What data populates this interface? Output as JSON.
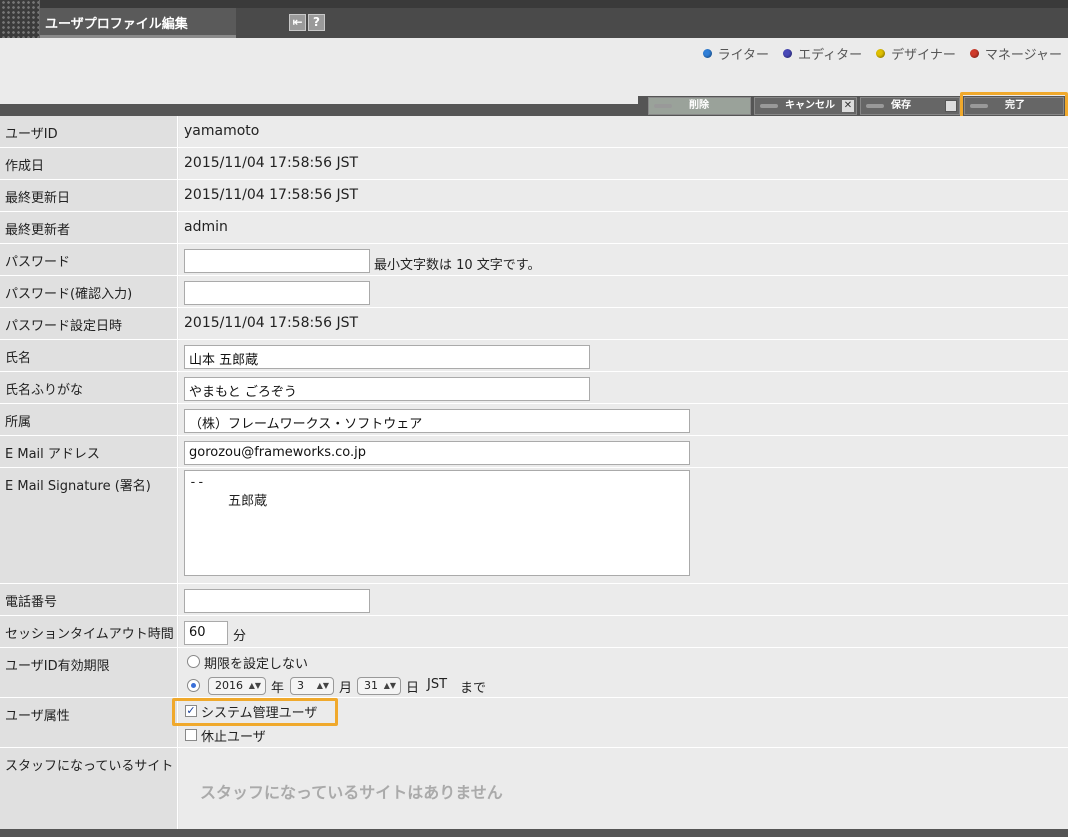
{
  "app": {
    "title": "ユーザプロファイル編集"
  },
  "legend": [
    {
      "label": "ライター",
      "color": "#2f7fd8"
    },
    {
      "label": "エディター",
      "color": "#4848b8"
    },
    {
      "label": "デザイナー",
      "color": "#e0c000"
    },
    {
      "label": "マネージャー",
      "color": "#d03a2a"
    }
  ],
  "toolbar": {
    "delete_label": "削除",
    "cancel_label": "キャンセル",
    "save_label": "保存",
    "done_label": "完了"
  },
  "fields": {
    "user_id": {
      "label": "ユーザID",
      "value": "yamamoto"
    },
    "created": {
      "label": "作成日",
      "value": "2015/11/04 17:58:56 JST"
    },
    "updated": {
      "label": "最終更新日",
      "value": "2015/11/04 17:58:56 JST"
    },
    "updater": {
      "label": "最終更新者",
      "value": "admin"
    },
    "password": {
      "label": "パスワード",
      "value": "",
      "hint": "最小文字数は 10 文字です。"
    },
    "password_confirm": {
      "label": "パスワード(確認入力)",
      "value": ""
    },
    "password_set": {
      "label": "パスワード設定日時",
      "value": "2015/11/04 17:58:56 JST"
    },
    "name": {
      "label": "氏名",
      "value": "山本 五郎蔵"
    },
    "name_kana": {
      "label": "氏名ふりがな",
      "value": "やまもと ごろぞう"
    },
    "org": {
      "label": "所属",
      "value": "（株）フレームワークス・ソフトウェア"
    },
    "email": {
      "label": "E Mail アドレス",
      "value": "gorozou@frameworks.co.jp"
    },
    "signature": {
      "label": "E Mail Signature (署名)",
      "value": "--\n     五郎蔵"
    },
    "phone": {
      "label": "電話番号",
      "value": ""
    },
    "timeout": {
      "label": "セッションタイムアウト時間",
      "value": "60",
      "unit": "分"
    },
    "expiry": {
      "label": "ユーザID有効期限",
      "no_limit_label": "期限を設定しない",
      "year": "2016",
      "year_unit": "年",
      "month": "3",
      "month_unit": "月",
      "day": "31",
      "day_unit": "日",
      "tz": "JST",
      "until": "まで"
    },
    "attributes": {
      "label": "ユーザ属性",
      "admin_label": "システム管理ユーザ",
      "suspended_label": "休止ユーザ"
    },
    "staff_sites": {
      "label": "スタッフになっているサイト",
      "empty_message": "スタッフになっているサイトはありません"
    }
  }
}
